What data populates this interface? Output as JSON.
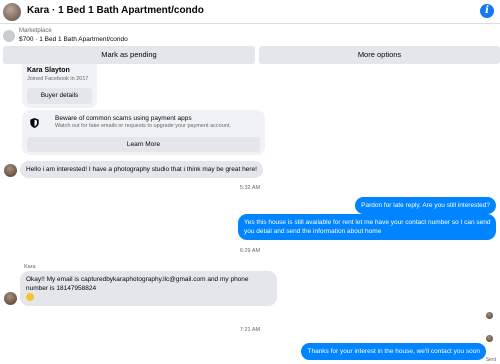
{
  "header": {
    "title": "Kara · 1 Bed 1 Bath Apartment/condo",
    "info_icon": "i"
  },
  "marketplace": {
    "label": "Marketplace",
    "listing": "$700 · 1 Bed 1 Bath Apartment/condo"
  },
  "actions": {
    "pending": "Mark as pending",
    "more": "More options"
  },
  "buyer_card": {
    "name": "Kara Slayton",
    "joined": "Joined Facebook in 2017",
    "button": "Buyer details"
  },
  "warning_card": {
    "title": "Beware of common scams using payment apps",
    "subtitle": "Watch out for fake emails or requests to upgrade your payment account.",
    "button": "Learn More"
  },
  "messages": {
    "m1": "Hello i am interested! I have a photography studio that i think may be great here!",
    "t1": "5:32 AM",
    "m2": "Pardon for late reply. Are you still interested?",
    "m3a": "Yes this house is still available for rent let me have your contact number so I can send",
    "m3b": "you detail and send the information about home",
    "t2": "6:29 AM",
    "sender": "Kara",
    "m4a": "Okay!! My email is capturedbykaraphotography.llc@gmail.com and my phone",
    "m4b": "number is 18147958824",
    "t3": "7:21 AM",
    "m5": "Thanks for your interest in the house, we'll contact you soon",
    "sent": "Sent"
  }
}
